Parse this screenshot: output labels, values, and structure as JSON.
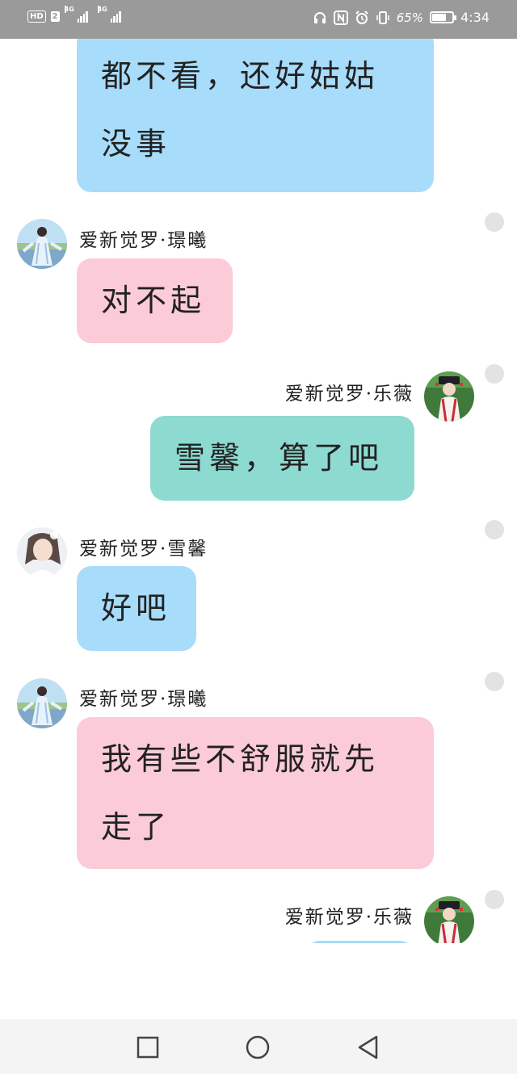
{
  "status_bar": {
    "hd_badge": "HD",
    "sim1_network": "4G",
    "sim1_number": "2",
    "sim2_network": "4G",
    "battery_percent_text": "65%",
    "battery_level": 0.65,
    "time": "4:34",
    "icons": [
      "headphones-icon",
      "nfc-icon",
      "alarm-icon",
      "vibrate-icon",
      "battery-icon"
    ]
  },
  "messages": [
    {
      "side": "left",
      "sender": "",
      "avatar": "none",
      "color": "#a7dcfa",
      "lines": [
        "都不看，还好姑姑",
        "没事"
      ]
    },
    {
      "side": "left",
      "sender": "爱新觉罗·璟曦",
      "avatar": "hanfu-woman-blue",
      "color": "#fccbd8",
      "lines": [
        "对不起"
      ]
    },
    {
      "side": "right",
      "sender": "爱新觉罗·乐薇",
      "avatar": "qing-princess",
      "color": "#8ddad1",
      "lines": [
        "雪馨，算了吧"
      ]
    },
    {
      "side": "left",
      "sender": "爱新觉罗·雪馨",
      "avatar": "woman-portrait",
      "color": "#a7dcfa",
      "lines": [
        "好吧"
      ]
    },
    {
      "side": "left",
      "sender": "爱新觉罗·璟曦",
      "avatar": "hanfu-woman-blue",
      "color": "#fccbd8",
      "lines": [
        "我有些不舒服就先",
        "走了"
      ]
    },
    {
      "side": "right",
      "sender": "爱新觉罗·乐薇",
      "avatar": "qing-princess",
      "color": "#a7dcfa",
      "lines": []
    }
  ],
  "nav_bar": {
    "buttons": [
      "recent-apps-button",
      "home-button",
      "back-button"
    ]
  }
}
